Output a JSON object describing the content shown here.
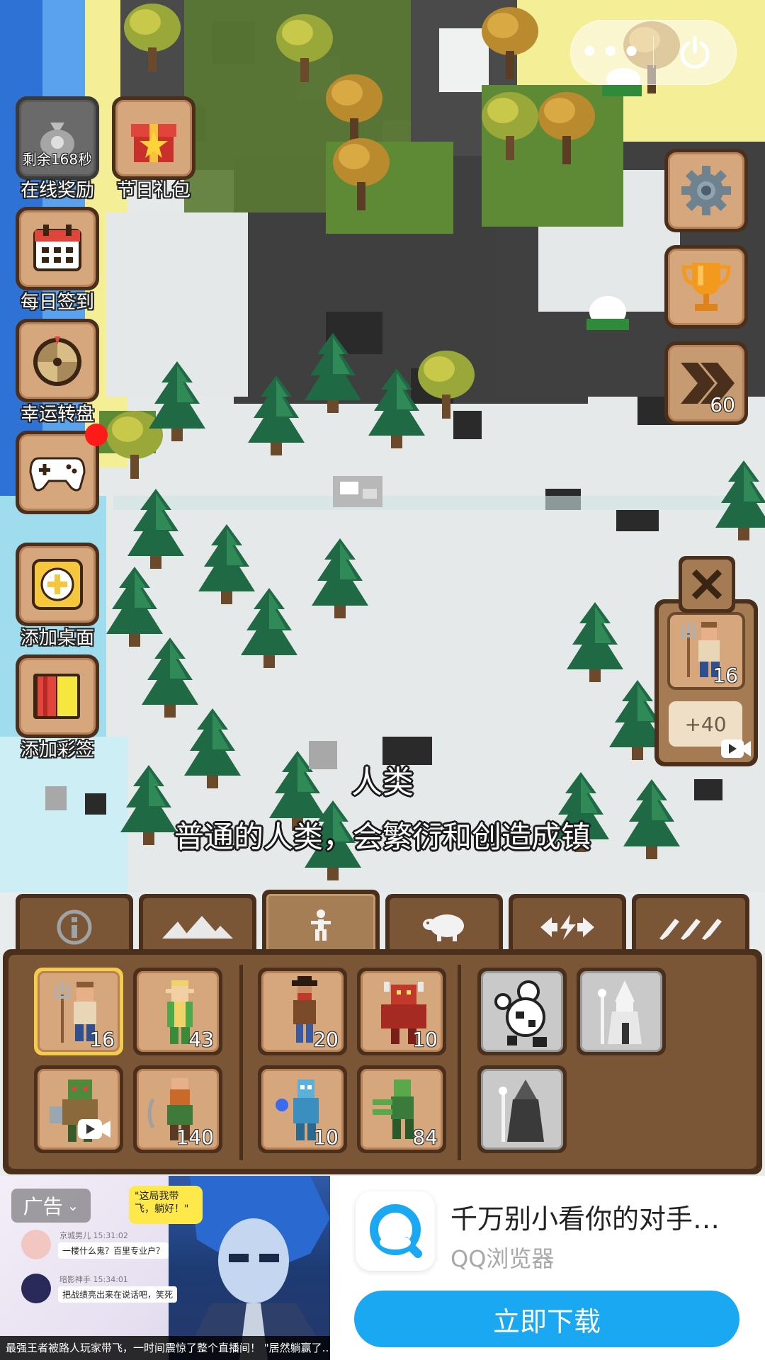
{
  "top_capsule": {
    "more_label": "•••",
    "power_icon": "power-icon"
  },
  "left_menu": [
    {
      "id": "online-reward",
      "label": "在线奖励",
      "sub": "剩余168秒",
      "icon": "money-bag-icon"
    },
    {
      "id": "holiday-gift",
      "label": "节日礼包",
      "icon": "gift-box-icon"
    },
    {
      "id": "daily-checkin",
      "label": "每日签到",
      "icon": "calendar-icon"
    },
    {
      "id": "lucky-wheel",
      "label": "幸运转盘",
      "icon": "wheel-icon"
    },
    {
      "id": "games",
      "label": "",
      "icon": "gamepad-icon",
      "badge": "red-dot"
    },
    {
      "id": "add-desktop",
      "label": "添加桌面",
      "icon": "plus-icon"
    },
    {
      "id": "add-tag",
      "label": "添加彩签",
      "icon": "bookmark-icon"
    }
  ],
  "right_menu": {
    "settings_icon": "gear-icon",
    "achievements_icon": "trophy-icon",
    "speed_icon": "fast-forward-icon",
    "speed_value": "60"
  },
  "selected_unit": {
    "icon": "farmer-icon",
    "count": "16",
    "bonus": "+40",
    "close_icon": "close-icon",
    "video_icon": "video-icon"
  },
  "info": {
    "title": "人类",
    "description": "普通的人类，会繁衍和创造成镇"
  },
  "tabs": [
    {
      "id": "info",
      "icon": "info-icon",
      "active": false
    },
    {
      "id": "terrain",
      "icon": "mountains-icon",
      "active": false
    },
    {
      "id": "creatures",
      "icon": "person-icon",
      "active": true
    },
    {
      "id": "animals",
      "icon": "sheep-icon",
      "active": false
    },
    {
      "id": "powers",
      "icon": "lightning-icon",
      "active": false
    },
    {
      "id": "tools",
      "icon": "brushes-icon",
      "active": false
    }
  ],
  "units": [
    {
      "id": "human",
      "count": "16",
      "selected": true
    },
    {
      "id": "elf",
      "count": "43"
    },
    {
      "id": "bandit",
      "count": "20"
    },
    {
      "id": "demon",
      "count": "10"
    },
    {
      "id": "snowman",
      "count": "",
      "locked": true
    },
    {
      "id": "white-mage",
      "count": "",
      "locked": true
    },
    {
      "id": "orc",
      "count": "",
      "video": true
    },
    {
      "id": "dwarf",
      "count": "140"
    },
    {
      "id": "ice-mage",
      "count": "10"
    },
    {
      "id": "zombie",
      "count": "84"
    },
    {
      "id": "necromancer",
      "count": "",
      "locked": true
    }
  ],
  "ad": {
    "tag": "广告",
    "bubble": "\"这局我带飞，躺好！\"",
    "chat": [
      {
        "name": "京城男儿  15:31:02",
        "msg": "一楼什么鬼？百里专业户？"
      },
      {
        "name": "暗影神手  15:34:01",
        "msg": "把战绩亮出来在说话吧，笑死"
      }
    ],
    "caption": "最强王者被路人玩家带飞，一时间震惊了整个直播间！ \"居然躺赢了...\"",
    "title": "千万别小看你的对手…",
    "app_name": "QQ浏览器",
    "cta": "立即下载"
  },
  "colors": {
    "wood_dark": "#4a2f1c",
    "wood_mid": "#7a5636",
    "wood_light": "#d6a67c",
    "selected_border": "#f2cc4a",
    "cta_blue": "#1aa8f2"
  }
}
